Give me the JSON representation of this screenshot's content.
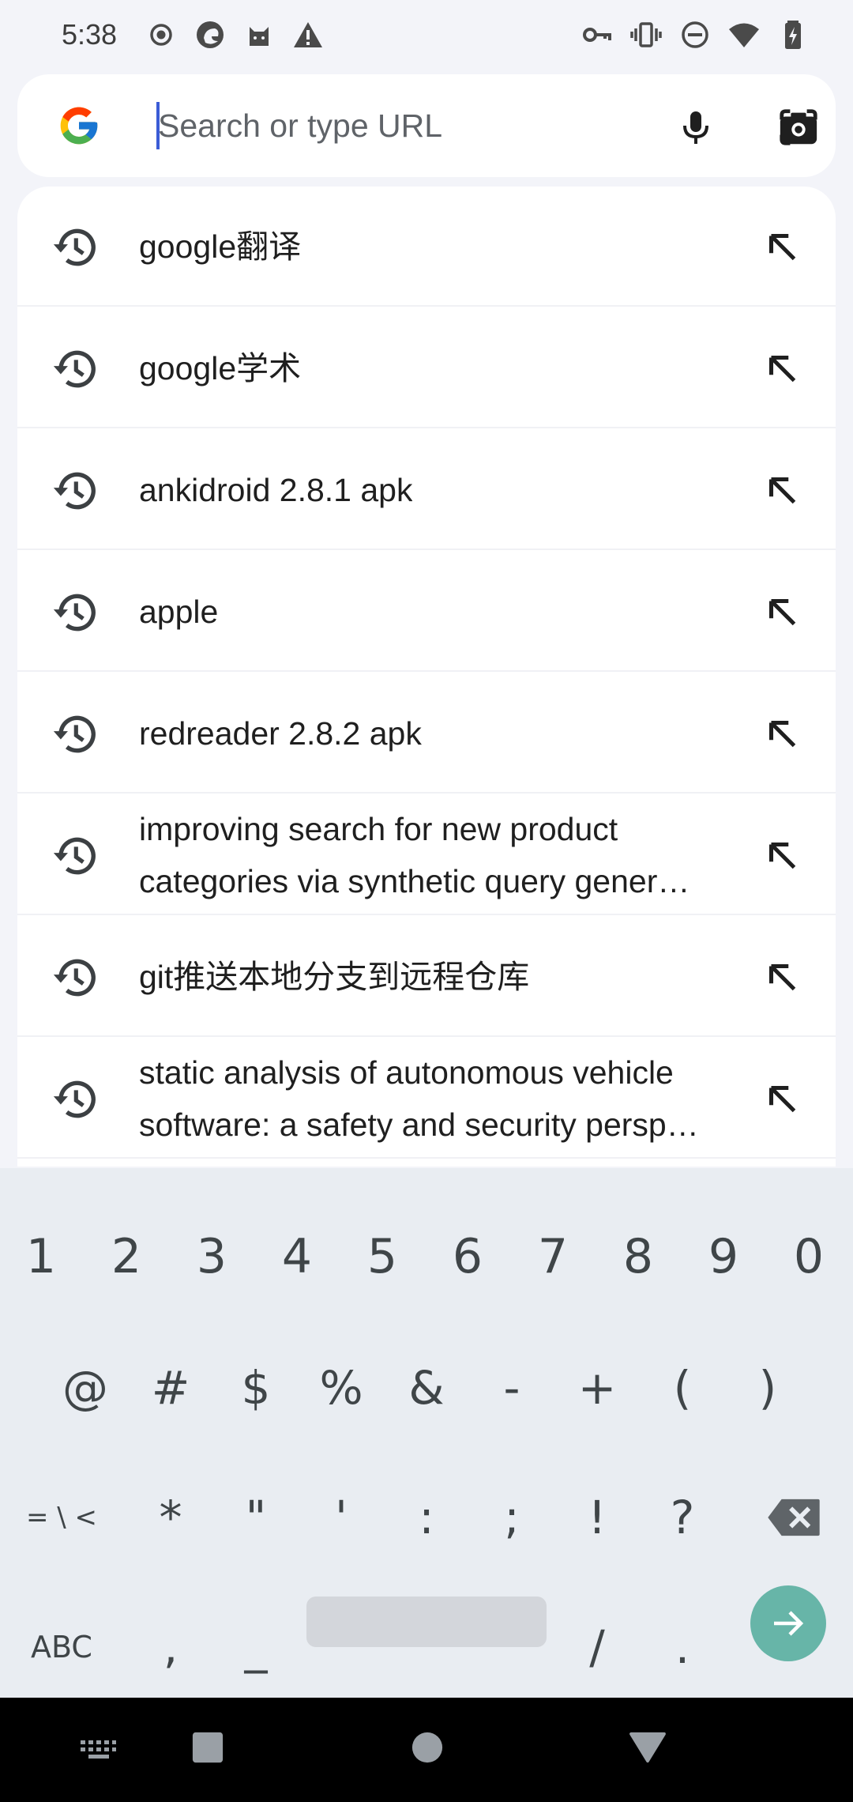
{
  "status_bar": {
    "time": "5:38",
    "left_icons": [
      "record-icon",
      "browser-app-icon",
      "cat-app-icon",
      "warning-icon"
    ],
    "right_icons": [
      "vpn-key-icon",
      "vibrate-icon",
      "do-not-disturb-icon",
      "wifi-icon",
      "battery-charging-icon"
    ]
  },
  "omnibox": {
    "placeholder": "Search or type URL",
    "value": "",
    "logo": "google-g-icon",
    "voice_icon": "microphone-icon",
    "lens_icon": "camera-lens-icon"
  },
  "suggestions": [
    {
      "text": "google翻译",
      "icon": "history-icon",
      "action_icon": "fill-arrow-icon"
    },
    {
      "text": "google学术",
      "icon": "history-icon",
      "action_icon": "fill-arrow-icon"
    },
    {
      "text": "ankidroid 2.8.1 apk",
      "icon": "history-icon",
      "action_icon": "fill-arrow-icon"
    },
    {
      "text": "apple",
      "icon": "history-icon",
      "action_icon": "fill-arrow-icon"
    },
    {
      "text": "redreader 2.8.2 apk",
      "icon": "history-icon",
      "action_icon": "fill-arrow-icon"
    },
    {
      "text": "improving search for new product categories via synthetic query gener…",
      "icon": "history-icon",
      "action_icon": "fill-arrow-icon"
    },
    {
      "text": "git推送本地分支到远程仓库",
      "icon": "history-icon",
      "action_icon": "fill-arrow-icon"
    },
    {
      "text": "static analysis of autonomous vehicle software: a safety and security persp…",
      "icon": "history-icon",
      "action_icon": "fill-arrow-icon"
    }
  ],
  "keyboard": {
    "row1": [
      "1",
      "2",
      "3",
      "4",
      "5",
      "6",
      "7",
      "8",
      "9",
      "0"
    ],
    "row2": [
      "@",
      "#",
      "$",
      "%",
      "&",
      "-",
      "+",
      "(",
      ")"
    ],
    "row3": [
      "= \\ <",
      "*",
      "\"",
      "'",
      ":",
      ";",
      "!",
      "?"
    ],
    "row3_backspace": "backspace-icon",
    "row4": {
      "abc": "ABC",
      "comma": ",",
      "underscore": "_",
      "slash": "/",
      "period": "."
    },
    "enter_icon": "arrow-right-icon",
    "colors": {
      "background": "#e9edf2",
      "enter": "#67b5a8",
      "space": "#d3d6db"
    }
  },
  "nav_bar": {
    "buttons": [
      "keyboard-switch-icon",
      "recents-square-icon",
      "home-circle-icon",
      "back-triangle-icon"
    ]
  }
}
